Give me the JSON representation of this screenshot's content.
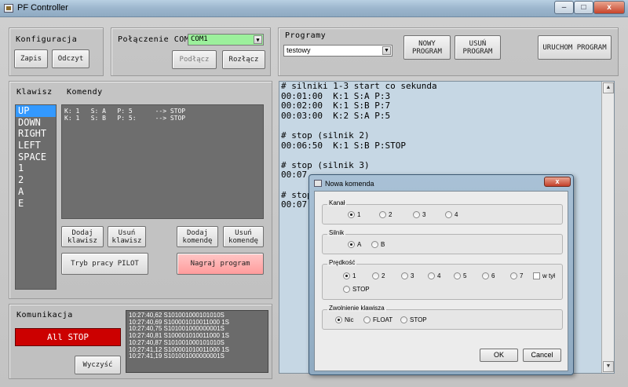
{
  "window": {
    "title": "PF Controller",
    "minimize": "–",
    "maximize": "□",
    "close": "x"
  },
  "konfiguracja": {
    "label": "Konfiguracja",
    "zapis": "Zapis",
    "odczyt": "Odczyt"
  },
  "com": {
    "label": "Połączenie COM",
    "port": "COM1",
    "podlacz": "Podłącz",
    "rozlacz": "Rozłącz"
  },
  "programy": {
    "label": "Programy",
    "selected": "testowy",
    "nowy": "NOWY PROGRAM",
    "usun": "USUŃ PROGRAM",
    "uruchom": "URUCHOM PROGRAM"
  },
  "klawisze": {
    "label": "Klawisz",
    "items": [
      "UP",
      "DOWN",
      "RIGHT",
      "LEFT",
      "SPACE",
      "1",
      "2",
      "A",
      "E"
    ],
    "selected_index": 0
  },
  "komendy": {
    "label": "Komendy",
    "items": [
      "K: 1   S: A   P: 5      --> STOP",
      "K: 1   S: B   P: 5:     --> STOP"
    ]
  },
  "buttons": {
    "dodaj_klawisz": "Dodaj klawisz",
    "usun_klawisz": "Usuń klawisz",
    "dodaj_komende": "Dodaj komendę",
    "usun_komende": "Usuń komendę",
    "tryb_pilot": "Tryb pracy PILOT",
    "nagraj": "Nagraj program"
  },
  "komunikacja": {
    "label": "Komunikacja",
    "all_stop": "All STOP",
    "wyczysc": "Wyczyść",
    "log": [
      "10:27:40,62 S101001000101010S",
      "10:27:40,69 S100001010011000 1S",
      "10:27:40,75 S101001000000001S",
      "10:27:40,81 S100001010011000 1S",
      "10:27:40,87 S101001000101010S",
      "10:27:41,12 S100001010011000 1S",
      "10:27:41,19 S101001000000001S"
    ]
  },
  "editor": {
    "lines": [
      "# silniki 1-3 start co sekunda",
      "00:01:00  K:1 S:A P:3",
      "00:02:00  K:1 S:B P:7",
      "00:03:00  K:2 S:A P:5",
      "",
      "# stop (silnik 2)",
      "00:06:50  K:1 S:B P:STOP",
      "",
      "# stop (silnik 3)",
      "00:07",
      "",
      "# stop",
      "00:07"
    ]
  },
  "dialog": {
    "title": "Nowa komenda",
    "close": "x",
    "kanal": {
      "label": "Kanał",
      "options": [
        "1",
        "2",
        "3",
        "4"
      ],
      "selected": "1"
    },
    "silnik": {
      "label": "Silnik",
      "options": [
        "A",
        "B"
      ],
      "selected": "A"
    },
    "predkosc": {
      "label": "Prędkość",
      "options": [
        "1",
        "2",
        "3",
        "4",
        "5",
        "6",
        "7",
        "STOP"
      ],
      "selected": "1",
      "wstecz_label": "w tył"
    },
    "zwolnienie": {
      "label": "Zwolnienie klawisza",
      "options": [
        "Nic",
        "FLOAT",
        "STOP"
      ],
      "selected": "Nic"
    },
    "ok": "OK",
    "cancel": "Cancel"
  }
}
